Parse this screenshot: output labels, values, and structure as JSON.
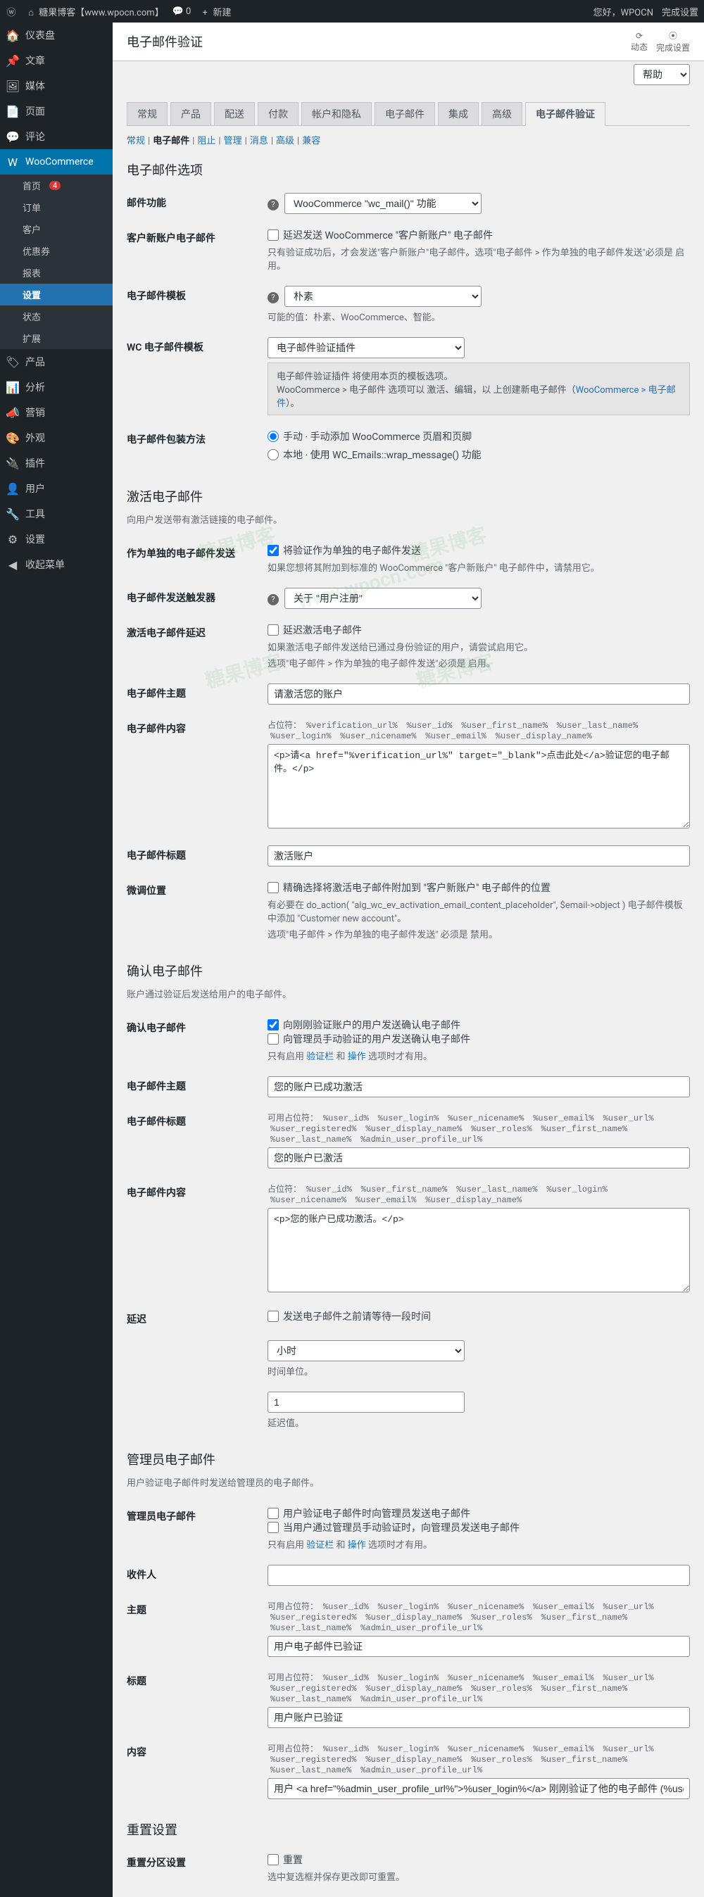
{
  "toolbar": {
    "site_name": "糖果博客【www.wpocn.com】",
    "comments": "0",
    "new": "新建",
    "howdy": "您好，WPOCN",
    "setup": "完成设置"
  },
  "menu": {
    "dashboard": "仪表盘",
    "posts": "文章",
    "media": "媒体",
    "pages": "页面",
    "comments": "评论",
    "woocommerce": "WooCommerce",
    "woo_sub": {
      "home": "首页",
      "home_badge": "4",
      "orders": "订单",
      "customers": "客户",
      "coupons": "优惠券",
      "reports": "报表",
      "settings": "设置",
      "status": "状态",
      "extensions": "扩展"
    },
    "products": "产品",
    "analytics": "分析",
    "marketing": "营销",
    "appearance": "外观",
    "plugins": "插件",
    "users": "用户",
    "tools": "工具",
    "settings_m": "设置",
    "collapse": "收起菜单"
  },
  "header": {
    "title": "电子邮件验证",
    "activity": "动态",
    "setup": "完成设置"
  },
  "nav_tabs": [
    "常规",
    "产品",
    "配送",
    "付款",
    "帐户和隐私",
    "电子邮件",
    "集成",
    "高级",
    "电子邮件验证"
  ],
  "sub_nav": [
    "常规",
    "电子邮件",
    "阻止",
    "管理",
    "消息",
    "高级",
    "兼容"
  ],
  "sub_nav_active": 1,
  "sections": {
    "email_options": {
      "title": "电子邮件选项",
      "email_function": {
        "label": "邮件功能",
        "value": "WooCommerce \"wc_mail()\" 功能"
      },
      "new_account": {
        "label": "客户新账户电子邮件",
        "checkbox": "延迟发送 WooCommerce \"客户新账户\" 电子邮件",
        "desc": "只有验证成功后，才会发送\"客户新账户\"电子邮件。选项\"电子邮件 > 作为单独的电子邮件发送\"必须是 启用。"
      },
      "template": {
        "label": "电子邮件模板",
        "value": "朴素",
        "desc": "可能的值：朴素、WooCommerce、智能。"
      },
      "wc_template": {
        "label": "WC 电子邮件模板",
        "value": "电子邮件验证插件",
        "box": "电子邮件验证插件 将使用本页的模板选项。",
        "box2": "WooCommerce > 电子邮件 选项可以 激活、编辑，以 上创建新电子邮件（WooCommerce > 电子邮件）。",
        "box_link": "WooCommerce > 电子邮件"
      },
      "wrap_method": {
        "label": "电子邮件包装方法",
        "manual": "手动 · 手动添加 WooCommerce 页眉和页脚",
        "local": "本地 · 使用 WC_Emails::wrap_message() 功能"
      }
    },
    "activation": {
      "title": "激活电子邮件",
      "desc": "向用户发送带有激活链接的电子邮件。",
      "send_separate": {
        "label": "作为单独的电子邮件发送",
        "checkbox": "将验证作为单独的电子邮件发送",
        "desc": "如果您想将其附加到标准的 WooCommerce \"客户新账户\" 电子邮件中，请禁用它。"
      },
      "trigger": {
        "label": "电子邮件发送触发器",
        "value": "关于 \"用户注册\""
      },
      "delay": {
        "label": "激活电子邮件延迟",
        "checkbox": "延迟激活电子邮件",
        "desc1": "如果激活电子邮件发送给已通过身份验证的用户，请尝试启用它。",
        "desc2": "选项\"电子邮件 > 作为单独的电子邮件发送\"必须是 启用。"
      },
      "subject": {
        "label": "电子邮件主题",
        "value": "请激活您的账户"
      },
      "content": {
        "label": "电子邮件内容",
        "hint": "占位符：",
        "placeholders": [
          "%verification_url%",
          "%user_id%",
          "%user_first_name%",
          "%user_last_name%",
          "%user_login%",
          "%user_nicename%",
          "%user_email%",
          "%user_display_name%"
        ],
        "value": "<p>请<a href=\"%verification_url%\" target=\"_blank\">点击此处</a>验证您的电子邮件。</p>"
      },
      "heading": {
        "label": "电子邮件标题",
        "value": "激活账户"
      },
      "fine_tune": {
        "label": "微调位置",
        "checkbox": "精确选择将激活电子邮件附加到 \"客户新账户\" 电子邮件的位置",
        "desc1": "有必要在 do_action( \"alg_wc_ev_activation_email_content_placeholder\", $email->object ) 电子邮件模板中添加 \"Customer new account\"。",
        "desc2": "选项\"电子邮件 > 作为单独的电子邮件发送\" 必须是 禁用。"
      }
    },
    "confirmation": {
      "title": "确认电子邮件",
      "desc": "账户通过验证后发送给用户的电子邮件。",
      "confirm": {
        "label": "确认电子邮件",
        "cb1": "向刚刚验证账户的用户发送确认电子邮件",
        "cb2": "向管理员手动验证的用户发送确认电子邮件",
        "desc": "只有启用 验证栏 和 操作 选项时才有用。",
        "link1": "验证栏",
        "link2": "操作"
      },
      "subject": {
        "label": "电子邮件主题",
        "value": "您的账户已成功激活"
      },
      "heading": {
        "label": "电子邮件标题",
        "hint": "可用占位符：",
        "placeholders": [
          "%user_id%",
          "%user_login%",
          "%user_nicename%",
          "%user_email%",
          "%user_url%",
          "%user_registered%",
          "%user_display_name%",
          "%user_roles%",
          "%user_first_name%",
          "%user_last_name%",
          "%admin_user_profile_url%"
        ],
        "value": "您的账户已激活"
      },
      "content": {
        "label": "电子邮件内容",
        "hint": "占位符：",
        "placeholders": [
          "%user_id%",
          "%user_first_name%",
          "%user_last_name%",
          "%user_login%",
          "%user_nicename%",
          "%user_email%",
          "%user_display_name%"
        ],
        "value": "<p>您的账户已成功激活。</p>"
      },
      "delay": {
        "label": "延迟",
        "checkbox": "发送电子邮件之前请等待一段时间",
        "unit_value": "小时",
        "unit_desc": "时间单位。",
        "value": "1",
        "value_desc": "延迟值。"
      }
    },
    "admin": {
      "title": "管理员电子邮件",
      "desc": "用户验证电子邮件时发送给管理员的电子邮件。",
      "enable": {
        "label": "管理员电子邮件",
        "cb1": "用户验证电子邮件时向管理员发送电子邮件",
        "cb2": "当用户通过管理员手动验证时，向管理员发送电子邮件",
        "desc": "只有启用 验证栏 和 操作 选项时才有用。",
        "link1": "验证栏",
        "link2": "操作"
      },
      "recipient": {
        "label": "收件人",
        "value": ""
      },
      "subject": {
        "label": "主题",
        "hint": "可用占位符：",
        "placeholders": [
          "%user_id%",
          "%user_login%",
          "%user_nicename%",
          "%user_email%",
          "%user_url%",
          "%user_registered%",
          "%user_display_name%",
          "%user_roles%",
          "%user_first_name%",
          "%user_last_name%",
          "%admin_user_profile_url%"
        ],
        "value": "用户电子邮件已验证"
      },
      "heading": {
        "label": "标题",
        "hint": "可用占位符：",
        "placeholders": [
          "%user_id%",
          "%user_login%",
          "%user_nicename%",
          "%user_email%",
          "%user_url%",
          "%user_registered%",
          "%user_display_name%",
          "%user_roles%",
          "%user_first_name%",
          "%user_last_name%",
          "%admin_user_profile_url%"
        ],
        "value": "用户账户已验证"
      },
      "content": {
        "label": "内容",
        "hint": "可用占位符：",
        "placeholders": [
          "%user_id%",
          "%user_login%",
          "%user_nicename%",
          "%user_email%",
          "%user_url%",
          "%user_registered%",
          "%user_display_name%",
          "%user_roles%",
          "%user_first_name%",
          "%user_last_name%",
          "%admin_user_profile_url%"
        ],
        "value": "用户 <a href=\"%admin_user_profile_url%\">%user_login%</a> 刚刚验证了他的电子邮件 (%user_email%)。"
      }
    },
    "reset": {
      "title": "重置设置",
      "label": "重置分区设置",
      "checkbox": "重置",
      "desc": "选中复选框并保存更改即可重置。"
    }
  },
  "help_label": "帮助"
}
